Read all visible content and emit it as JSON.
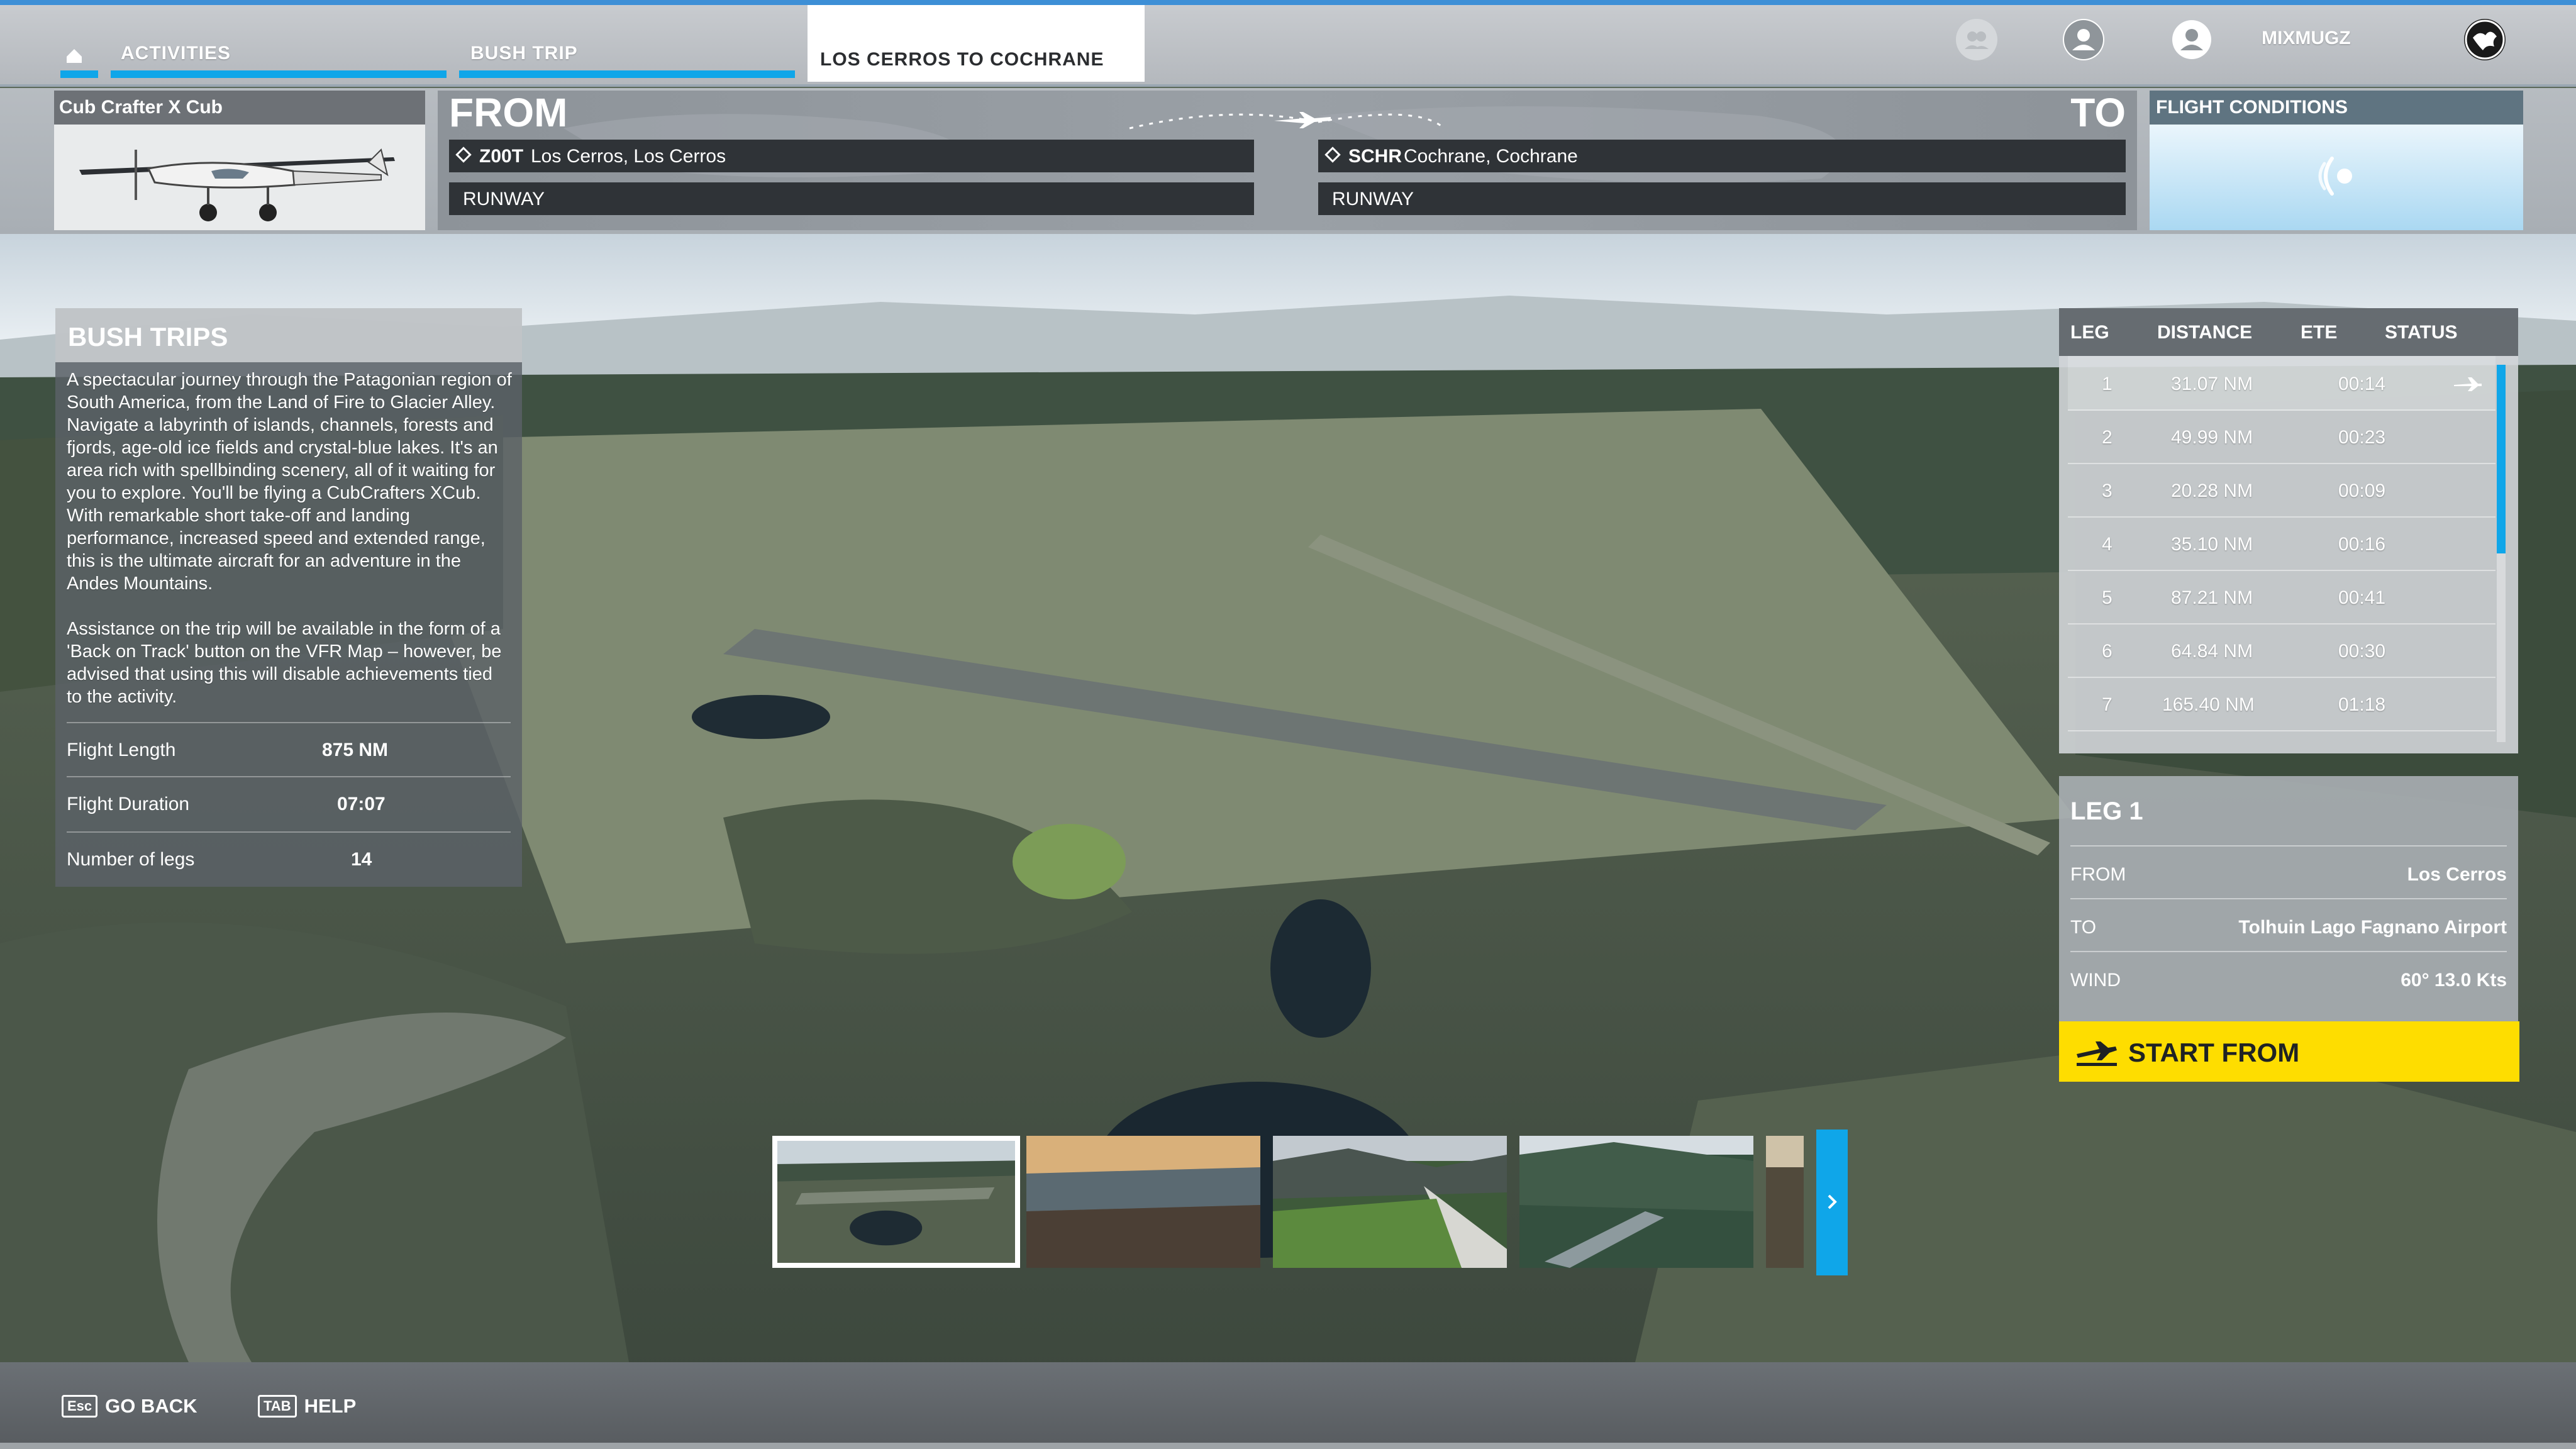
{
  "nav": {
    "tabs": [
      {
        "label": "ACTIVITIES"
      },
      {
        "label": "BUSH TRIP"
      },
      {
        "label": "LOS CERROS TO COCHRANE"
      }
    ],
    "username": "MIXMUGZ",
    "accent_color": "#0fa6e9"
  },
  "aircraft": {
    "name": "Cub Crafter X Cub"
  },
  "route": {
    "from_label": "FROM",
    "to_label": "TO",
    "from": {
      "code": "Z00T",
      "name": "Los Cerros, Los Cerros",
      "runway": "RUNWAY"
    },
    "to": {
      "code": "SCHR",
      "name": "Cochrane, Cochrane",
      "runway": "RUNWAY"
    }
  },
  "flight_conditions": {
    "title": "FLIGHT CONDITIONS",
    "icon": "weather-icon"
  },
  "bush_trips": {
    "title": "BUSH TRIPS",
    "description": "A spectacular journey through the Patagonian region of South America, from the Land of Fire to Glacier Alley. Navigate a labyrinth of islands, channels, forests and fjords, age-old ice fields and crystal-blue lakes. It's an area rich with spellbinding scenery, all of it waiting for you to explore. You'll be flying a CubCrafters XCub. With remarkable short take-off and landing performance, increased speed and extended range, this is the ultimate aircraft for an adventure in the Andes Mountains.\n\nAssistance on the trip will be available in the form of a 'Back on Track' button on the VFR Map – however, be advised that using this will disable achievements tied to the activity.",
    "stats": [
      {
        "label": "Flight Length",
        "value": "875 NM"
      },
      {
        "label": "Flight Duration",
        "value": "07:07"
      },
      {
        "label": "Number of legs",
        "value": "14"
      }
    ]
  },
  "legs": {
    "headers": [
      "LEG",
      "DISTANCE",
      "ETE",
      "STATUS"
    ],
    "rows": [
      {
        "leg": "1",
        "distance": "31.07 NM",
        "ete": "00:14",
        "status_icon": "plane-icon"
      },
      {
        "leg": "2",
        "distance": "49.99 NM",
        "ete": "00:23"
      },
      {
        "leg": "3",
        "distance": "20.28 NM",
        "ete": "00:09"
      },
      {
        "leg": "4",
        "distance": "35.10 NM",
        "ete": "00:16"
      },
      {
        "leg": "5",
        "distance": "87.21 NM",
        "ete": "00:41"
      },
      {
        "leg": "6",
        "distance": "64.84 NM",
        "ete": "00:30"
      },
      {
        "leg": "7",
        "distance": "165.40 NM",
        "ete": "01:18"
      }
    ]
  },
  "leg_detail": {
    "title": "LEG 1",
    "rows": [
      {
        "label": "FROM",
        "value": "Los Cerros"
      },
      {
        "label": "TO",
        "value": "Tolhuin Lago Fagnano Airport"
      },
      {
        "label": "WIND",
        "value": "60° 13.0 Kts"
      }
    ]
  },
  "start_button": {
    "label": "START FROM",
    "color": "#fedd00"
  },
  "footer": {
    "go_back": {
      "key": "Esc",
      "label": "GO BACK"
    },
    "help": {
      "key": "TAB",
      "label": "HELP"
    }
  }
}
